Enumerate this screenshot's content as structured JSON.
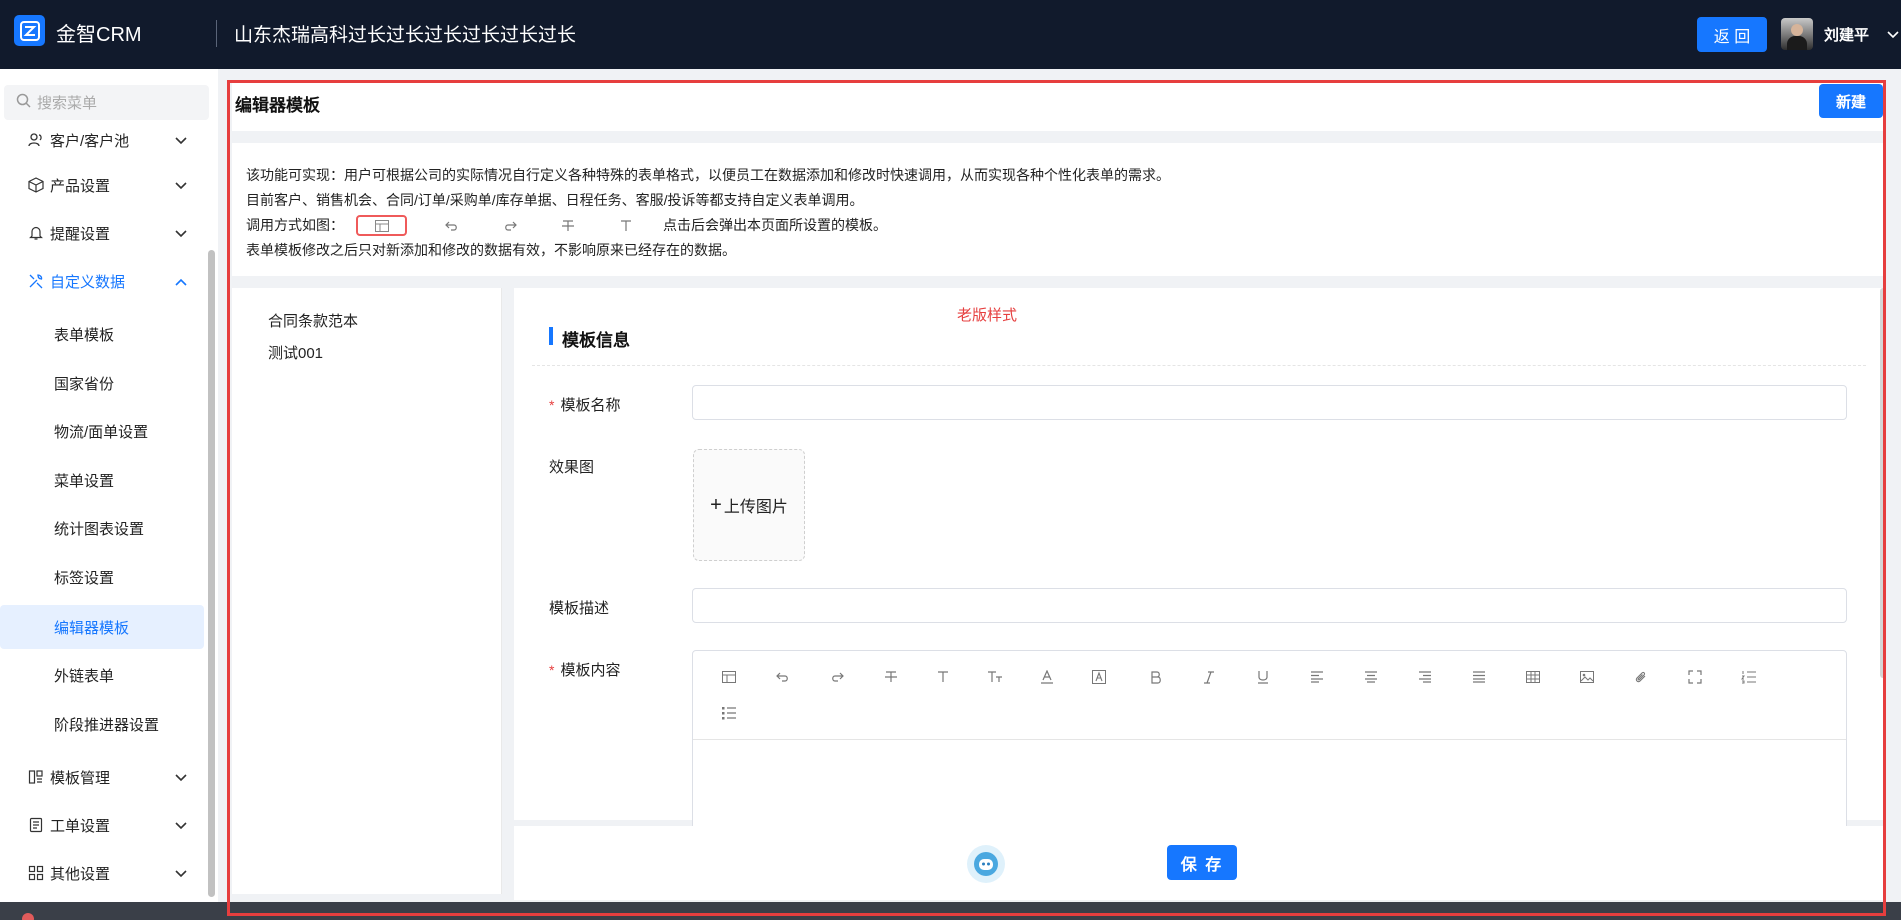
{
  "header": {
    "app_name": "金智CRM",
    "company": "山东杰瑞高科过长过长过长过长过长过长",
    "back_label": "返 回",
    "username": "刘建平"
  },
  "sidebar": {
    "search_placeholder": "搜索菜单",
    "items": [
      {
        "label": "客户/客户池",
        "icon": "user-group-icon"
      },
      {
        "label": "产品设置",
        "icon": "box-icon"
      },
      {
        "label": "提醒设置",
        "icon": "bell-icon"
      },
      {
        "label": "自定义数据",
        "icon": "tools-icon"
      }
    ],
    "sub_items": [
      {
        "label": "表单模板"
      },
      {
        "label": "国家省份"
      },
      {
        "label": "物流/面单设置"
      },
      {
        "label": "菜单设置"
      },
      {
        "label": "统计图表设置"
      },
      {
        "label": "标签设置"
      },
      {
        "label": "编辑器模板",
        "selected": true
      },
      {
        "label": "外链表单"
      },
      {
        "label": "阶段推进器设置"
      }
    ],
    "bottom_items": [
      {
        "label": "模板管理",
        "icon": "template-icon"
      },
      {
        "label": "工单设置",
        "icon": "document-icon"
      },
      {
        "label": "其他设置",
        "icon": "grid-icon"
      }
    ]
  },
  "page": {
    "title": "编辑器模板",
    "new_label": "新建",
    "description": {
      "line1": "该功能可实现：用户可根据公司的实际情况自行定义各种特殊的表单格式，以便员工在数据添加和修改时快速调用，从而实现各种个性化表单的需求。",
      "line2": "目前客户、销售机会、合同/订单/采购单/库存单据、日程任务、客服/投诉等都支持自定义表单调用。",
      "line3_prefix": "调用方式如图：",
      "line3_suffix": "点击后会弹出本页面所设置的模板。",
      "line4": "表单模板修改之后只对新添加和修改的数据有效，不影响原来已经存在的数据。"
    },
    "template_list": [
      "合同条款范本",
      "测试001"
    ],
    "old_style_label": "老版样式",
    "section_title": "模板信息",
    "form": {
      "name_label": "模板名称",
      "name_value": "",
      "image_label": "效果图",
      "upload_label": "上传图片",
      "desc_label": "模板描述",
      "desc_value": "",
      "content_label": "模板内容",
      "required_mark": "*"
    },
    "save_label": "保 存"
  },
  "colors": {
    "primary": "#1677ff",
    "header_bg": "#111a2c",
    "highlight_red": "#e63e3e"
  }
}
